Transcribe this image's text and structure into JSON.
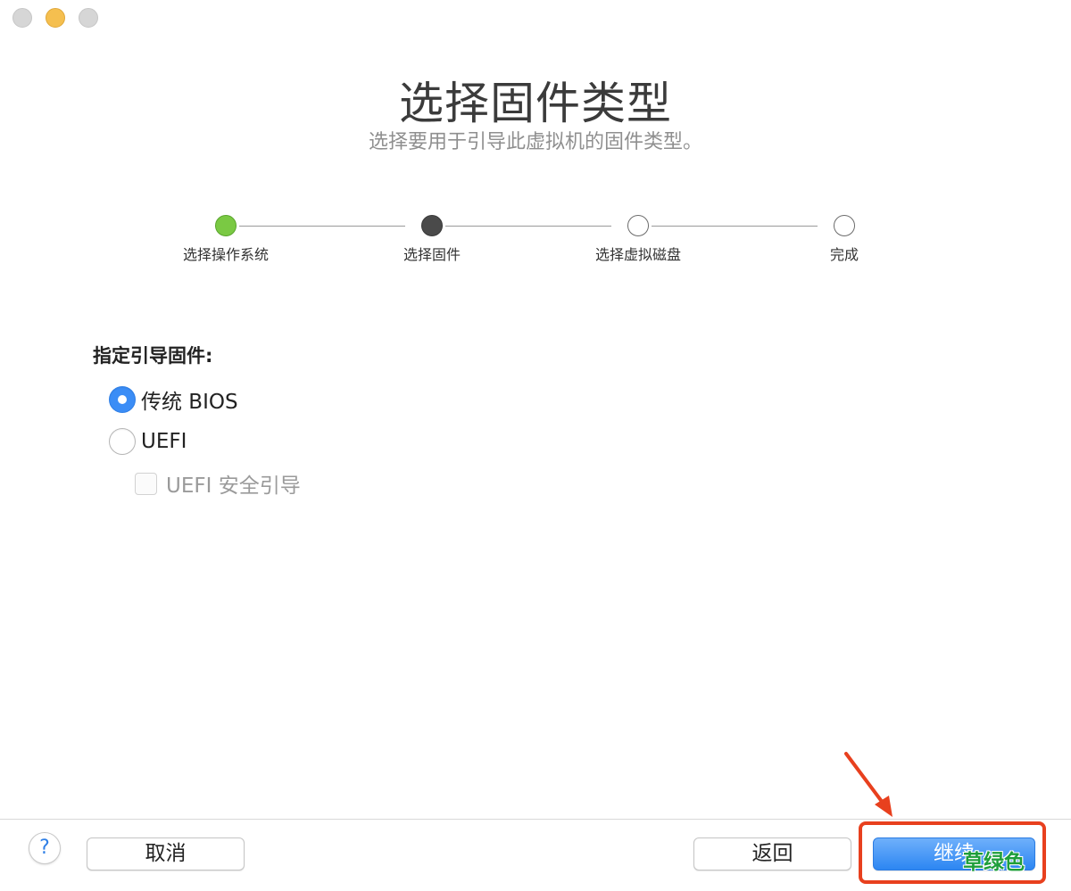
{
  "window": {
    "controls": [
      "close",
      "minimize",
      "zoom"
    ]
  },
  "header": {
    "title": "选择固件类型",
    "subtitle": "选择要用于引导此虚拟机的固件类型。"
  },
  "stepper": {
    "steps": [
      {
        "label": "选择操作系统",
        "state": "done"
      },
      {
        "label": "选择固件",
        "state": "current"
      },
      {
        "label": "选择虚拟磁盘",
        "state": "pending"
      },
      {
        "label": "完成",
        "state": "pending"
      }
    ]
  },
  "firmware": {
    "section_label": "指定引导固件:",
    "options": [
      {
        "label": "传统 BIOS",
        "selected": true
      },
      {
        "label": "UEFI",
        "selected": false
      }
    ],
    "secure_boot": {
      "label": "UEFI 安全引导",
      "checked": false,
      "enabled": false
    }
  },
  "footer": {
    "help_label": "?",
    "cancel_label": "取消",
    "back_label": "返回",
    "continue_label": "继续"
  },
  "annotation": {
    "watermark_text": "草绿色",
    "highlight_color": "#e8401e"
  },
  "colors": {
    "accent": "#3b8df6",
    "step_done": "#7ac943",
    "step_current": "#4a4a4a"
  }
}
